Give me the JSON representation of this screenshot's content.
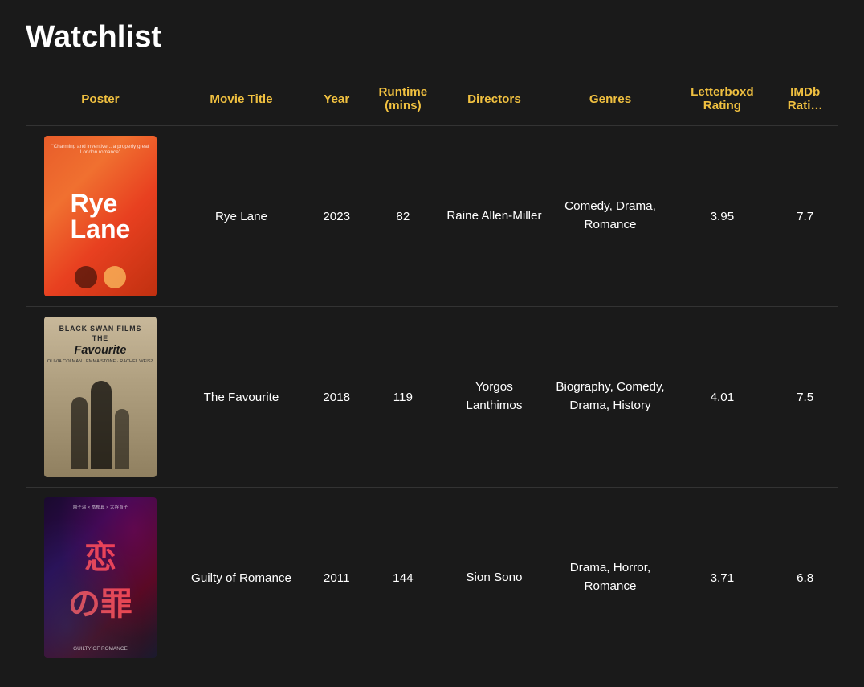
{
  "page": {
    "title": "Watchlist"
  },
  "columns": {
    "poster": "Poster",
    "movie_title": "Movie Title",
    "year": "Year",
    "runtime": "Runtime (mins)",
    "directors": "Directors",
    "genres": "Genres",
    "letterboxd": "Letterboxd Rating",
    "imdb": "IMDb Rati…"
  },
  "movies": [
    {
      "id": "rye-lane",
      "title": "Rye Lane",
      "year": "2023",
      "runtime": "82",
      "director": "Raine Allen-Miller",
      "genres": "Comedy, Drama, Romance",
      "letterboxd": "3.95",
      "imdb": "7.7",
      "poster_label": "Rye Lane"
    },
    {
      "id": "the-favourite",
      "title": "The Favourite",
      "year": "2018",
      "runtime": "119",
      "director": "Yorgos Lanthimos",
      "genres": "Biography, Comedy, Drama, History",
      "letterboxd": "4.01",
      "imdb": "7.5",
      "poster_label": "The Favourite"
    },
    {
      "id": "guilty-of-romance",
      "title": "Guilty of Romance",
      "year": "2011",
      "runtime": "144",
      "director": "Sion Sono",
      "genres": "Drama, Horror, Romance",
      "letterboxd": "3.71",
      "imdb": "6.8",
      "poster_label": "Guilty of Romance"
    }
  ]
}
